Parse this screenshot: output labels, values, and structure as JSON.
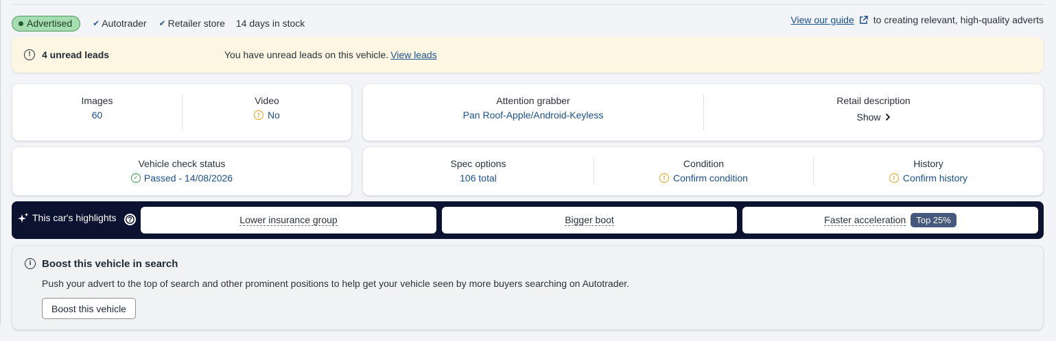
{
  "status": {
    "advertised": "Advertised",
    "tags": [
      "Autotrader",
      "Retailer store"
    ],
    "days_in_stock": "14 days in stock"
  },
  "guide": {
    "link": "View our guide",
    "text": "to creating relevant, high-quality adverts"
  },
  "leads": {
    "count": "4 unread leads",
    "message": "You have unread leads on this vehicle.",
    "link": "View leads"
  },
  "media": {
    "images_label": "Images",
    "images_value": "60",
    "video_label": "Video",
    "video_value": "No"
  },
  "attention": {
    "label": "Attention grabber",
    "value": "Pan Roof-Apple/Android-Keyless",
    "retail_label": "Retail description",
    "retail_action": "Show"
  },
  "vehicle_check": {
    "label": "Vehicle check status",
    "value": "Passed - 14/08/2026"
  },
  "spec": {
    "options_label": "Spec options",
    "options_value": "106 total",
    "condition_label": "Condition",
    "condition_value": "Confirm condition",
    "history_label": "History",
    "history_value": "Confirm history"
  },
  "highlights": {
    "title": "This car's highlights",
    "help": "?",
    "items": [
      {
        "label": "Lower insurance group"
      },
      {
        "label": "Bigger boot"
      },
      {
        "label": "Faster acceleration",
        "badge": "Top 25%"
      }
    ]
  },
  "boost": {
    "title": "Boost this vehicle in search",
    "description": "Push your advert to the top of search and other prominent positions to help get your vehicle seen by more buyers searching on Autotrader.",
    "button": "Boost this vehicle"
  },
  "colors": {
    "link": "#1a4f8f",
    "advertised_bg": "#a6ddb0",
    "leads_bg": "#fdf6e3",
    "highlights_bg": "#0c1330",
    "warning": "#e8a317",
    "success": "#2f9a4a",
    "badge_bg": "#46587b"
  }
}
